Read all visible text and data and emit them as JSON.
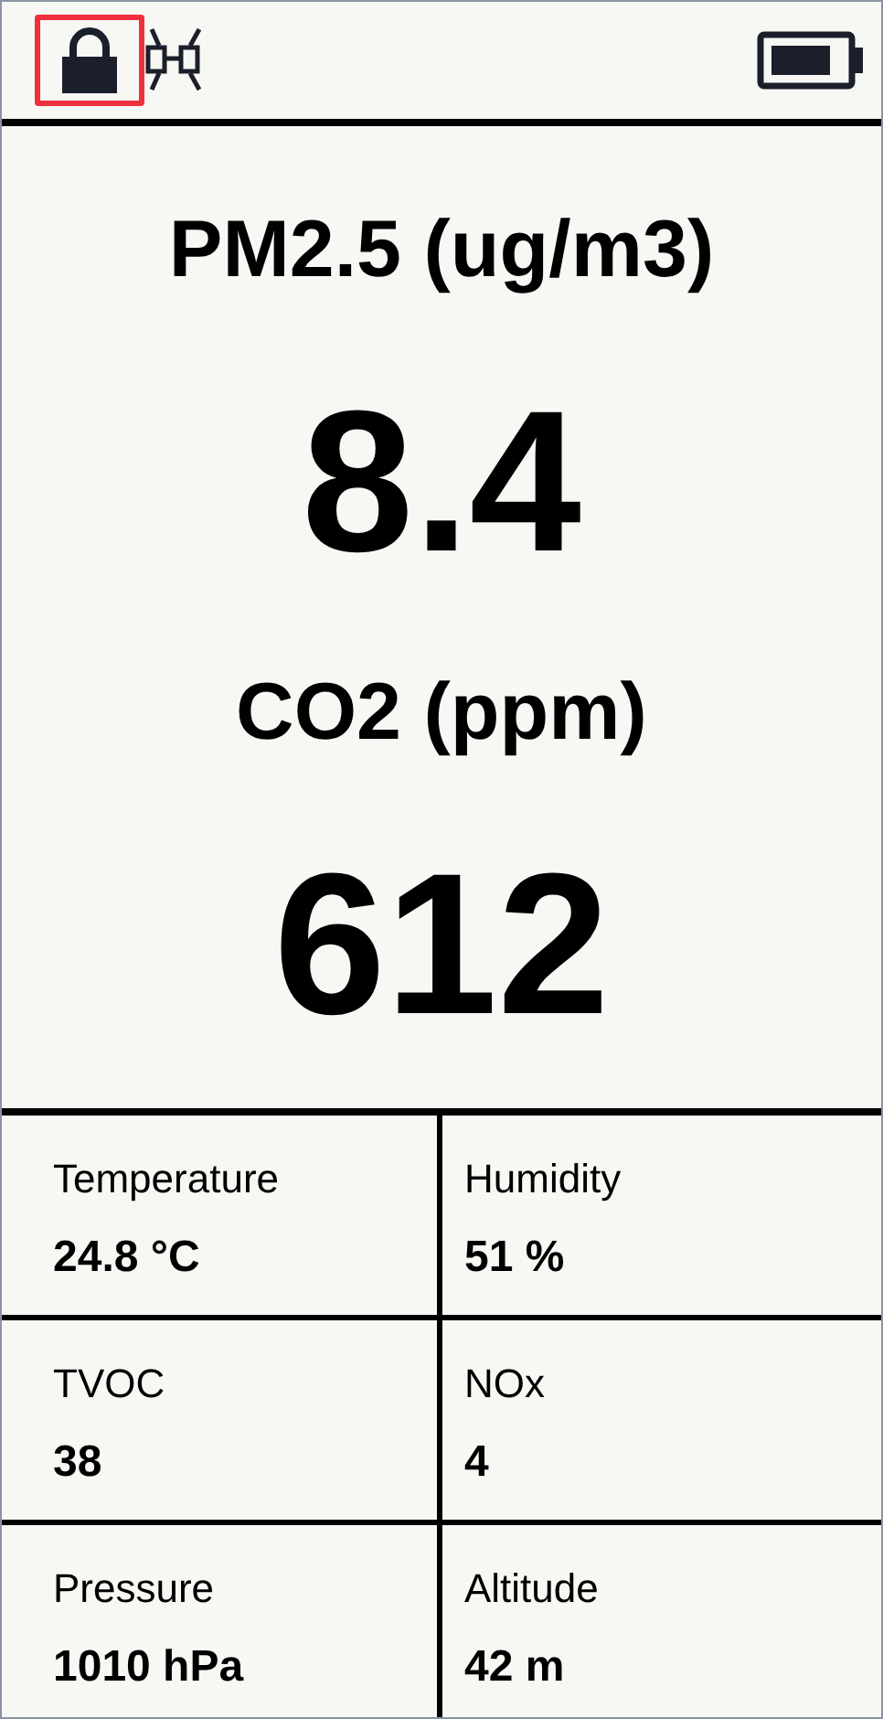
{
  "status_bar": {
    "lock_highlighted": true
  },
  "primary": [
    {
      "label": "PM2.5 (ug/m3)",
      "value": "8.4"
    },
    {
      "label": "CO2 (ppm)",
      "value": "612"
    }
  ],
  "readings": [
    {
      "label": "Temperature",
      "value": "24.8 °C"
    },
    {
      "label": "Humidity",
      "value": "51 %"
    },
    {
      "label": "TVOC",
      "value": "38"
    },
    {
      "label": "NOx",
      "value": "4"
    },
    {
      "label": "Pressure",
      "value": "1010 hPa"
    },
    {
      "label": "Altitude",
      "value": "42 m"
    }
  ]
}
